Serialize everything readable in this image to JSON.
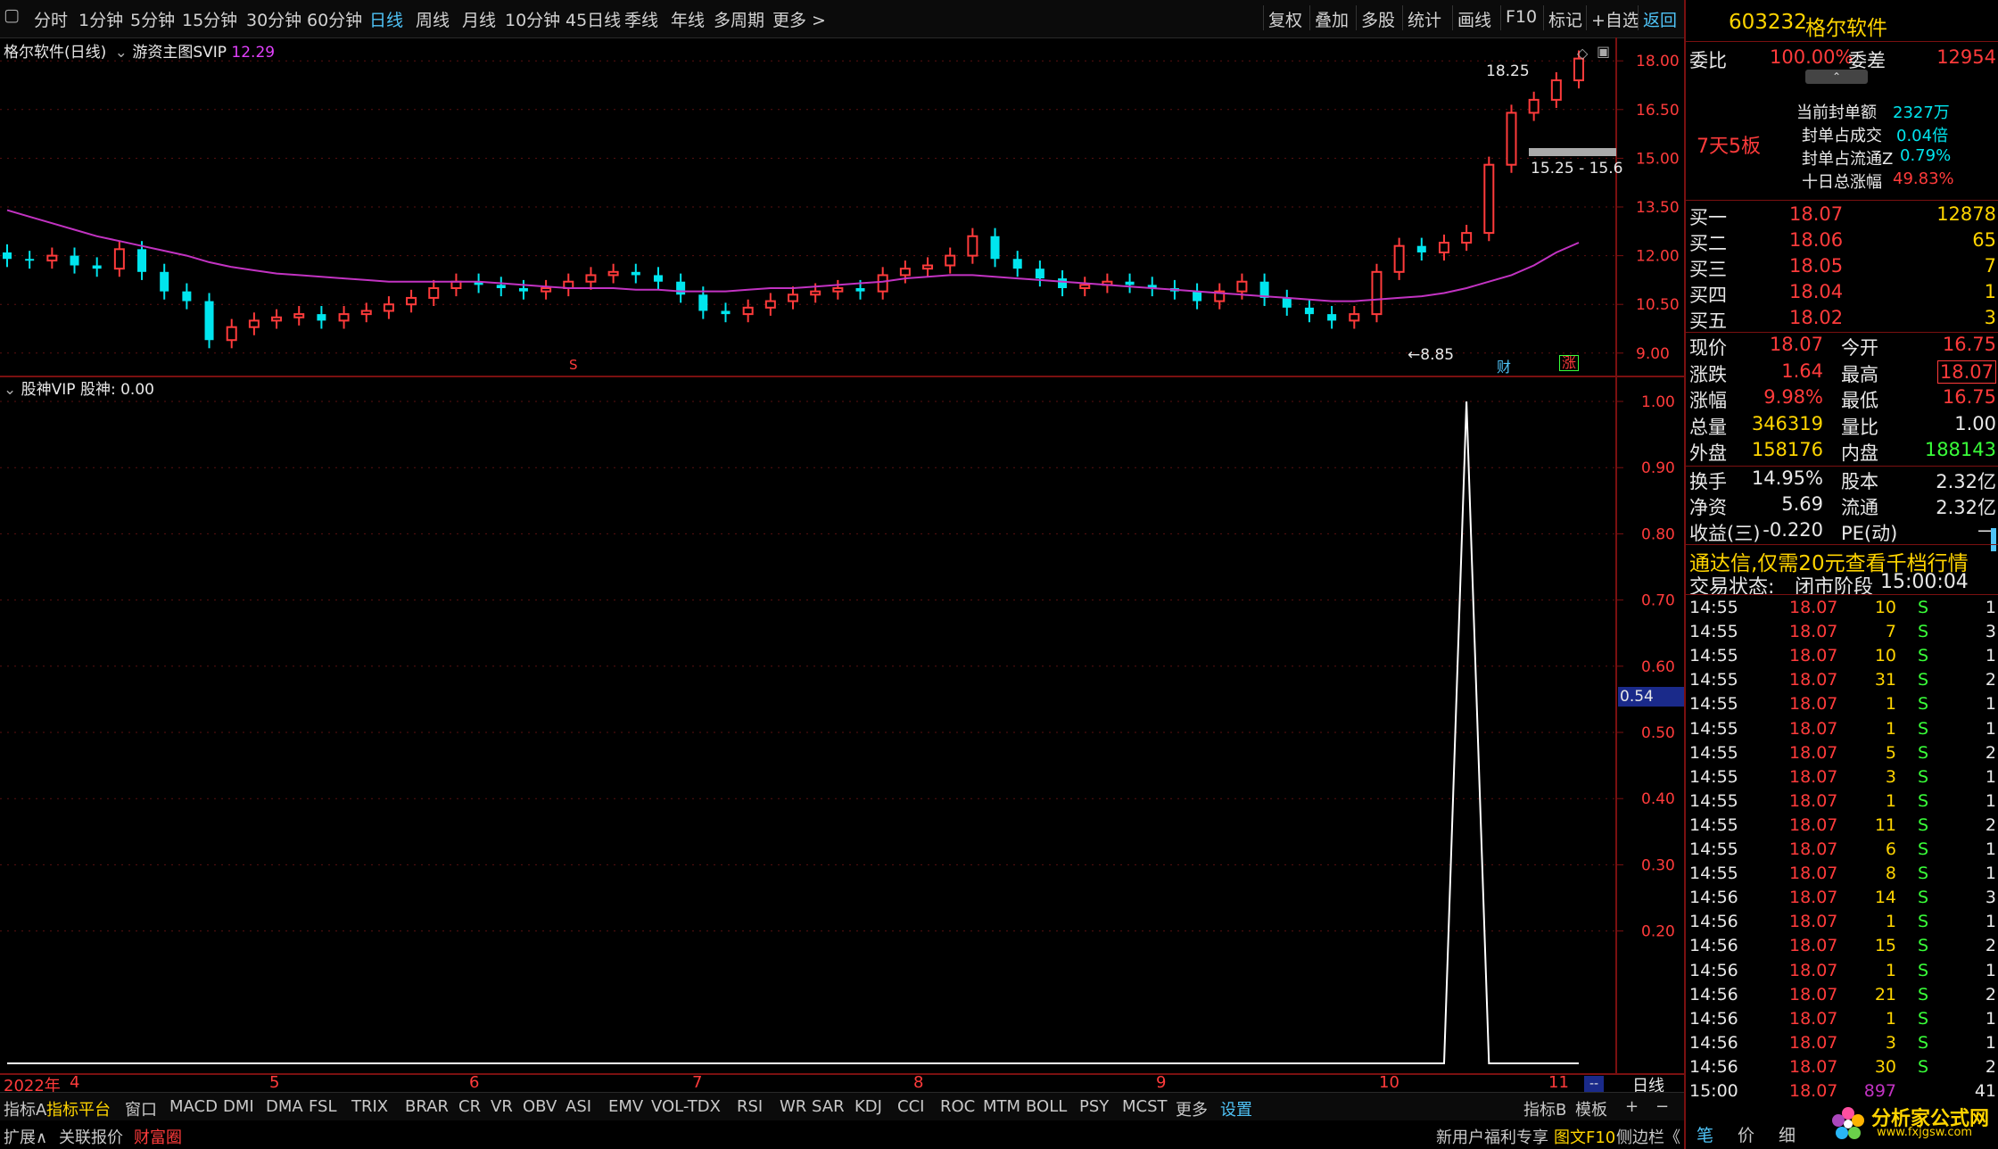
{
  "toolbar": {
    "period_tabs": [
      "分时",
      "1分钟",
      "5分钟",
      "15分钟",
      "30分钟",
      "60分钟",
      "日线",
      "周线",
      "月线",
      "10分钟",
      "45日线",
      "季线",
      "年线",
      "多周期",
      "更多 >"
    ],
    "active_tab": "日线",
    "right_tabs": [
      "复权",
      "叠加",
      "多股",
      "统计",
      "画线",
      "F10",
      "标记",
      "+自选",
      "返回"
    ]
  },
  "chart_legend": {
    "title": "格尔软件(日线)",
    "indicator": "游资主图SVIP",
    "value": "12.29"
  },
  "sub_legend": {
    "name": "股神VIP",
    "label": "股神: 0.00"
  },
  "main_annotations": {
    "high_label": "18.25",
    "low_label": "8.85",
    "range_label": "15.25 - 15.6",
    "marker_s": "S",
    "marker_cai": "财",
    "marker_zhang": "涨"
  },
  "main_yaxis": [
    "18.00",
    "16.50",
    "15.00",
    "13.50",
    "12.00",
    "10.50",
    "9.00"
  ],
  "sub_yaxis": [
    "1.00",
    "0.90",
    "0.80",
    "0.70",
    "0.60",
    "0.50",
    "0.40",
    "0.30",
    "0.20"
  ],
  "sub_current": "0.54",
  "xaxis": [
    {
      "label": "2022年"
    },
    {
      "label": "4"
    },
    {
      "label": "5"
    },
    {
      "label": "6"
    },
    {
      "label": "7"
    },
    {
      "label": "8"
    },
    {
      "label": "9"
    },
    {
      "label": "10"
    },
    {
      "label": "11"
    }
  ],
  "xaxis_right": "日线",
  "bottom_tabs": [
    "指标A",
    "指标平台",
    "窗口",
    "MACD",
    "DMI",
    "DMA",
    "FSL",
    "TRIX",
    "BRAR",
    "CR",
    "VR",
    "OBV",
    "ASI",
    "EMV",
    "VOL-TDX",
    "RSI",
    "WR",
    "SAR",
    "KDJ",
    "CCI",
    "ROC",
    "MTM",
    "BOLL",
    "PSY",
    "MCST",
    "更多",
    "设置"
  ],
  "bottom_right_tabs": [
    "指标B",
    "模板",
    "+",
    "−"
  ],
  "bottom2_left": [
    "扩展∧",
    "关联报价",
    "财富圈"
  ],
  "bottom2_right": [
    "新用户福利专享",
    "图文F10",
    "侧边栏《"
  ],
  "quote": {
    "code": "603232",
    "name": "格尔软件",
    "weibi_label": "委比",
    "weibi": "100.00%",
    "weicha_label": "委差",
    "weicha": "12954",
    "tag": "7天5板",
    "seal_amount_label": "当前封单额",
    "seal_amount": "2327万",
    "seal_vol_label": "封单占成交",
    "seal_vol": "0.04倍",
    "seal_float_label": "封单占流通Z",
    "seal_float": "0.79%",
    "ten_day_label": "十日总涨幅",
    "ten_day": "49.83%",
    "bids": [
      {
        "label": "买一",
        "price": "18.07",
        "vol": "12878"
      },
      {
        "label": "买二",
        "price": "18.06",
        "vol": "65"
      },
      {
        "label": "买三",
        "price": "18.05",
        "vol": "7"
      },
      {
        "label": "买四",
        "price": "18.04",
        "vol": "1"
      },
      {
        "label": "买五",
        "price": "18.02",
        "vol": "3"
      }
    ],
    "stats": [
      {
        "l1": "现价",
        "v1": "18.07",
        "l2": "今开",
        "v2": "16.75"
      },
      {
        "l1": "涨跌",
        "v1": "1.64",
        "l2": "最高",
        "v2": "18.07"
      },
      {
        "l1": "涨幅",
        "v1": "9.98%",
        "l2": "最低",
        "v2": "16.75"
      },
      {
        "l1": "总量",
        "v1": "346319",
        "l2": "量比",
        "v2": "1.00"
      },
      {
        "l1": "外盘",
        "v1": "158176",
        "l2": "内盘",
        "v2": "188143"
      }
    ],
    "stats2": [
      {
        "l1": "换手",
        "v1": "14.95%",
        "l2": "股本",
        "v2": "2.32亿"
      },
      {
        "l1": "净资",
        "v1": "5.69",
        "l2": "流通",
        "v2": "2.32亿"
      },
      {
        "l1": "收益(三)",
        "v1": "-0.220",
        "l2": "PE(动)",
        "v2": "—"
      }
    ],
    "promo": "通达信,仅需20元查看千档行情",
    "status_label": "交易状态:",
    "status": "闭市阶段",
    "status_time": "15:00:04"
  },
  "trades": [
    {
      "t": "14:55",
      "p": "18.07",
      "v": "10",
      "s": "S",
      "n": "1"
    },
    {
      "t": "14:55",
      "p": "18.07",
      "v": "7",
      "s": "S",
      "n": "3"
    },
    {
      "t": "14:55",
      "p": "18.07",
      "v": "10",
      "s": "S",
      "n": "1"
    },
    {
      "t": "14:55",
      "p": "18.07",
      "v": "31",
      "s": "S",
      "n": "2"
    },
    {
      "t": "14:55",
      "p": "18.07",
      "v": "1",
      "s": "S",
      "n": "1"
    },
    {
      "t": "14:55",
      "p": "18.07",
      "v": "1",
      "s": "S",
      "n": "1"
    },
    {
      "t": "14:55",
      "p": "18.07",
      "v": "5",
      "s": "S",
      "n": "2"
    },
    {
      "t": "14:55",
      "p": "18.07",
      "v": "3",
      "s": "S",
      "n": "1"
    },
    {
      "t": "14:55",
      "p": "18.07",
      "v": "1",
      "s": "S",
      "n": "1"
    },
    {
      "t": "14:55",
      "p": "18.07",
      "v": "11",
      "s": "S",
      "n": "2"
    },
    {
      "t": "14:55",
      "p": "18.07",
      "v": "6",
      "s": "S",
      "n": "1"
    },
    {
      "t": "14:55",
      "p": "18.07",
      "v": "8",
      "s": "S",
      "n": "1"
    },
    {
      "t": "14:56",
      "p": "18.07",
      "v": "14",
      "s": "S",
      "n": "3"
    },
    {
      "t": "14:56",
      "p": "18.07",
      "v": "1",
      "s": "S",
      "n": "1"
    },
    {
      "t": "14:56",
      "p": "18.07",
      "v": "15",
      "s": "S",
      "n": "2"
    },
    {
      "t": "14:56",
      "p": "18.07",
      "v": "1",
      "s": "S",
      "n": "1"
    },
    {
      "t": "14:56",
      "p": "18.07",
      "v": "21",
      "s": "S",
      "n": "2"
    },
    {
      "t": "14:56",
      "p": "18.07",
      "v": "1",
      "s": "S",
      "n": "1"
    },
    {
      "t": "14:56",
      "p": "18.07",
      "v": "3",
      "s": "S",
      "n": "1"
    },
    {
      "t": "14:56",
      "p": "18.07",
      "v": "30",
      "s": "S",
      "n": "2"
    },
    {
      "t": "15:00",
      "p": "18.07",
      "v": "897",
      "s": "",
      "n": "41"
    }
  ],
  "footer_tabs": [
    "笔",
    "价",
    "细"
  ],
  "watermark": {
    "name": "分析家公式网",
    "url": "www.fxjgsw.com"
  },
  "chart_data": {
    "type": "line",
    "series": [
      {
        "values": [
          11.9,
          11.85,
          12.0,
          11.7,
          11.6,
          12.2,
          11.5,
          10.9,
          10.6,
          9.4,
          9.8,
          10.0,
          10.1,
          10.2,
          10.0,
          10.2,
          10.3,
          10.5,
          10.7,
          11.0,
          11.2,
          11.1,
          11.0,
          10.9,
          11.0,
          11.2,
          11.4,
          11.5,
          11.4,
          11.2,
          10.8,
          10.3,
          10.2,
          10.4,
          10.6,
          10.8,
          10.9,
          11.0,
          10.9,
          11.4,
          11.6,
          11.7,
          12.0,
          12.6,
          11.9,
          11.6,
          11.3,
          11.0,
          11.1,
          11.2,
          11.1,
          11.0,
          10.9,
          10.6,
          10.9,
          11.2,
          10.7,
          10.4,
          10.2,
          10.0,
          10.2,
          11.5,
          12.3,
          12.1,
          12.4,
          12.7,
          14.8,
          16.4,
          16.8,
          17.4,
          18.07
        ]
      },
      {
        "values": [
          13.4,
          13.2,
          13.0,
          12.8,
          12.6,
          12.45,
          12.3,
          12.15,
          12.0,
          11.8,
          11.65,
          11.55,
          11.45,
          11.4,
          11.35,
          11.3,
          11.25,
          11.2,
          11.2,
          11.2,
          11.2,
          11.2,
          11.15,
          11.1,
          11.05,
          11.0,
          11.0,
          11.0,
          10.95,
          10.95,
          10.9,
          10.9,
          10.9,
          10.95,
          11.0,
          11.0,
          11.05,
          11.1,
          11.15,
          11.2,
          11.3,
          11.35,
          11.4,
          11.4,
          11.35,
          11.3,
          11.25,
          11.2,
          11.15,
          11.1,
          11.05,
          11.0,
          10.95,
          10.9,
          10.85,
          10.8,
          10.75,
          10.7,
          10.65,
          10.6,
          10.6,
          10.65,
          10.7,
          10.75,
          10.85,
          11.0,
          11.2,
          11.4,
          11.7,
          12.1,
          12.4
        ]
      },
      {
        "values": [
          0,
          0,
          0,
          0,
          0,
          0,
          0,
          0,
          0,
          0,
          0,
          0,
          0,
          0,
          0,
          0,
          0,
          0,
          0,
          0,
          0,
          0,
          0,
          0,
          0,
          0,
          0,
          0,
          0,
          0,
          0,
          0,
          0,
          0,
          0,
          0,
          0,
          0,
          0,
          0,
          0,
          0,
          0,
          0,
          0,
          0,
          0,
          0,
          0,
          0,
          0,
          0,
          0,
          0,
          0,
          0,
          0,
          0,
          0,
          0,
          0,
          0,
          0,
          0,
          0,
          1.0,
          0,
          0,
          0,
          0,
          0
        ]
      }
    ],
    "ylim": [
      8.5,
      18.5
    ],
    "ylim_sub": [
      0,
      1.0
    ],
    "xlabel": "",
    "ylabel": ""
  }
}
